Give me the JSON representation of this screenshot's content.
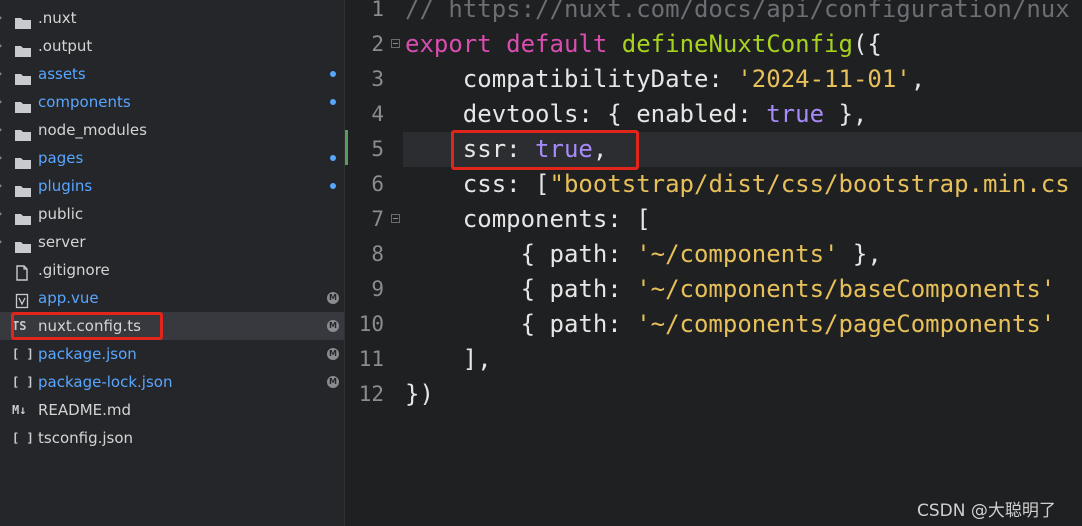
{
  "explorer": {
    "items": [
      {
        "label": ".nuxt",
        "kind": "folder",
        "color": "default",
        "status": ""
      },
      {
        "label": ".output",
        "kind": "folder",
        "color": "default",
        "status": ""
      },
      {
        "label": "assets",
        "kind": "folder",
        "color": "blue",
        "status": "dot"
      },
      {
        "label": "components",
        "kind": "folder",
        "color": "blue",
        "status": "dot"
      },
      {
        "label": "node_modules",
        "kind": "folder",
        "color": "default",
        "status": ""
      },
      {
        "label": "pages",
        "kind": "folder",
        "color": "blue",
        "status": "dot"
      },
      {
        "label": "plugins",
        "kind": "folder",
        "color": "blue",
        "status": "dot"
      },
      {
        "label": "public",
        "kind": "folder",
        "color": "default",
        "status": ""
      },
      {
        "label": "server",
        "kind": "folder",
        "color": "default",
        "status": ""
      },
      {
        "label": ".gitignore",
        "kind": "file",
        "color": "default",
        "status": ""
      },
      {
        "label": "app.vue",
        "kind": "vue",
        "color": "blue",
        "status": "M"
      },
      {
        "label": "nuxt.config.ts",
        "kind": "ts",
        "icon_text": "TS",
        "color": "default",
        "status": "M",
        "active": true
      },
      {
        "label": "package.json",
        "kind": "json",
        "icon_text": "[ ]",
        "color": "blue",
        "status": "M"
      },
      {
        "label": "package-lock.json",
        "kind": "json",
        "icon_text": "[ ]",
        "color": "blue",
        "status": "M"
      },
      {
        "label": "README.md",
        "kind": "md",
        "icon_text": "M↓",
        "color": "default",
        "status": ""
      },
      {
        "label": "tsconfig.json",
        "kind": "json",
        "icon_text": "[ ]",
        "color": "default",
        "status": ""
      }
    ]
  },
  "editor": {
    "lines": [
      {
        "num": "1",
        "tokens": [
          {
            "t": "// https://nuxt.com/docs/api/configuration/nux",
            "c": "comment"
          }
        ]
      },
      {
        "num": "2",
        "fold": true,
        "tokens": [
          {
            "t": "export",
            "c": "kw"
          },
          {
            "t": " ",
            "c": "punc"
          },
          {
            "t": "default",
            "c": "kw"
          },
          {
            "t": " ",
            "c": "punc"
          },
          {
            "t": "defineNuxtConfig",
            "c": "fn"
          },
          {
            "t": "({",
            "c": "punc"
          }
        ]
      },
      {
        "num": "3",
        "tokens": [
          {
            "t": "    compatibilityDate: ",
            "c": "punc"
          },
          {
            "t": "'2024-11-01'",
            "c": "str"
          },
          {
            "t": ",",
            "c": "punc"
          }
        ]
      },
      {
        "num": "4",
        "tokens": [
          {
            "t": "    devtools: { enabled: ",
            "c": "punc"
          },
          {
            "t": "true",
            "c": "bool"
          },
          {
            "t": " },",
            "c": "punc"
          }
        ]
      },
      {
        "num": "5",
        "current": true,
        "tokens": [
          {
            "t": "    ssr: ",
            "c": "punc"
          },
          {
            "t": "true",
            "c": "bool"
          },
          {
            "t": ",",
            "c": "punc"
          }
        ]
      },
      {
        "num": "6",
        "tokens": [
          {
            "t": "    css: [",
            "c": "punc"
          },
          {
            "t": "\"bootstrap/dist/css/bootstrap.min.cs",
            "c": "str"
          }
        ]
      },
      {
        "num": "7",
        "fold": true,
        "tokens": [
          {
            "t": "    components: [",
            "c": "punc"
          }
        ]
      },
      {
        "num": "8",
        "tokens": [
          {
            "t": "        { path: ",
            "c": "punc"
          },
          {
            "t": "'~/components'",
            "c": "str"
          },
          {
            "t": " },",
            "c": "punc"
          }
        ]
      },
      {
        "num": "9",
        "tokens": [
          {
            "t": "        { path: ",
            "c": "punc"
          },
          {
            "t": "'~/components/baseComponents'",
            "c": "str"
          },
          {
            "t": " ",
            "c": "punc"
          }
        ]
      },
      {
        "num": "10",
        "tokens": [
          {
            "t": "        { path: ",
            "c": "punc"
          },
          {
            "t": "'~/components/pageComponents'",
            "c": "str"
          },
          {
            "t": " ",
            "c": "punc"
          }
        ]
      },
      {
        "num": "11",
        "tokens": [
          {
            "t": "    ],",
            "c": "punc"
          }
        ]
      },
      {
        "num": "12",
        "tokens": [
          {
            "t": "})",
            "c": "punc"
          }
        ]
      }
    ]
  },
  "watermark": "CSDN @大聪明了",
  "colors": {
    "highlight_box": "#e1251b",
    "folder_accent": "#58a6ff",
    "keyword": "#d94db0",
    "function": "#a6d31e",
    "string": "#e8c05a",
    "boolean": "#a78bfa"
  }
}
